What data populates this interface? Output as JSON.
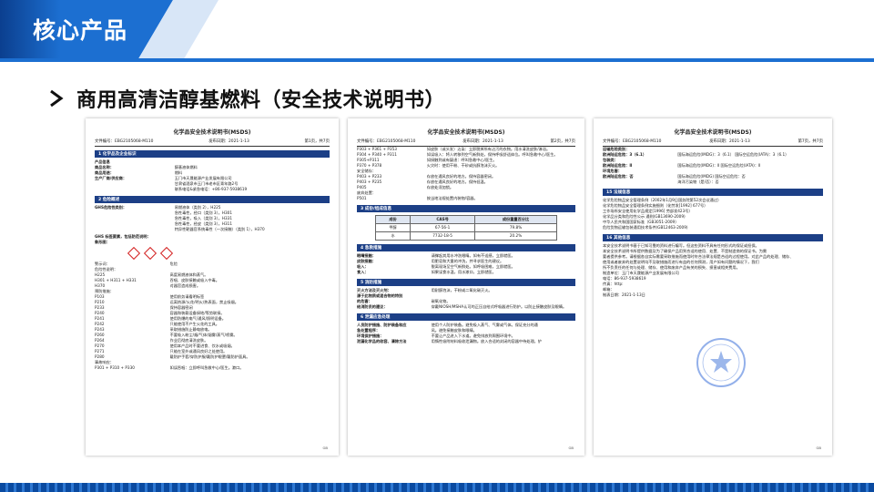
{
  "header": {
    "title": "核心产品",
    "bg_color": "#1c6fd1",
    "accent_color": "#0b3f8f"
  },
  "subtitle": {
    "icon": "triangle-arrow-icon",
    "text": "商用高清洁醇基燃料（安全技术说明书）"
  },
  "docs": [
    {
      "title": "化学品安全技术说明书(MSDS)",
      "meta": [
        "文件编号：EBG2105068-M110",
        "发布日期：2021-1-13",
        "第1页，共7页"
      ],
      "sections": [
        {
          "heading": "1 化学品及企业标识",
          "rows": [
            [
              "产品信息",
              ""
            ],
            [
              "商品名称：",
              "醇基液体燃料"
            ],
            [
              "商品用途：",
              "燃料"
            ],
            [
              "生产厂商/供应商：",
              "玉门市天晟能源产业发展有限公司"
            ],
            [
              "",
              "甘肃省酒泉市玉门市老市区青年路2号"
            ],
            [
              "",
              "联系电话&紧急电话：+86-937-5938619"
            ]
          ]
        },
        {
          "heading": "2 危险概述",
          "rows": [
            [
              "GHS危险性类别：",
              "易燃液体（类别 2），H225"
            ],
            [
              "",
              "急性毒性，经口（类别 3），H301"
            ],
            [
              "",
              "急性毒性，吸入（类别 3），H331"
            ],
            [
              "",
              "急性毒性，经皮（类别 3），H311"
            ],
            [
              "",
              "特异性靶器官系统毒性（一次接触）（类别 1），H370"
            ]
          ]
        }
      ],
      "ghs_label": "GHS 标签要素，包括防范说明：",
      "pictogram_label": "象形图：",
      "rows_after": [
        [
          "警示词：",
          "危险"
        ],
        [
          "危险性说明：",
          ""
        ],
        [
          "H225",
          "高度易燃液体和蒸气。"
        ],
        [
          "H301 + H311 + H331",
          "吞咽、皮肤接触或吸入中毒。"
        ],
        [
          "H370",
          "对器官造成损害。"
        ],
        [
          "预防措施：",
          ""
        ],
        [
          "P103",
          "使用前务请看明标签"
        ],
        [
          "P210",
          "远离热源/火花/明火/热表面，禁止吸烟。"
        ],
        [
          "P233",
          "保持容器密闭"
        ],
        [
          "P240",
          "容器和装载设备接地/等势联接。"
        ],
        [
          "P241",
          "使用防爆的电气/通风/照明设备。"
        ],
        [
          "P242",
          "只能使用不产生火花的工具。"
        ],
        [
          "P243",
          "采取措施防止静电放电。"
        ],
        [
          "P260",
          "不要吸入粉尘/烟/气体/烟雾/蒸气/喷雾。"
        ],
        [
          "P264",
          "作业后彻底清洗皮肤。"
        ],
        [
          "P270",
          "使用本产品时不要进食、饮水或吸烟。"
        ],
        [
          "P271",
          "只能在室外或通风良好之处使用。"
        ],
        [
          "P280",
          "戴防护手套/穿防护服/戴防护眼罩/戴防护面具。"
        ],
        [
          "事故响应：",
          ""
        ],
        [
          "P301 + P310 + P330",
          "如误吞咽：立即呼叫急救中心/医生。漱口。"
        ]
      ],
      "footer": "GB"
    },
    {
      "title": "化学品安全技术说明书(MSDS)",
      "meta": [
        "文件编号：EBG2105068-M110",
        "发布日期：2021-1-13",
        "第2页，共7页"
      ],
      "rows_top": [
        [
          "P303 + P361 + P353",
          "如皮肤（或头发）沾染：立即脱掉所有沾污的衣物。用水清洗皮肤/淋浴。"
        ],
        [
          "P304 + P340 + P311",
          "如误吸入：将人转移到空气新鲜处，保持呼吸舒适体位。呼叫急救中心/医生。"
        ],
        [
          "P305+P311",
          "如接触到或有疑虑：呼叫急救中心/医生。"
        ],
        [
          "P370 + P378",
          "火灾时：使用干粉、干砂或抗醇泡沫灭火。"
        ],
        [
          "安全储存：",
          ""
        ],
        [
          "P403 + P233",
          "存放在通风良好的地方。保持容器密闭。"
        ],
        [
          "P403 + P235",
          "存放在通风良好的地方。保持低温。"
        ],
        [
          "P405",
          "存放处须加锁。"
        ],
        [
          "废弃处置：",
          ""
        ],
        [
          "P501",
          "按当地法规处置内装物/容器。"
        ]
      ],
      "sec3": "3 成份/组成信息",
      "comp_table": {
        "headers": [
          "成份",
          "CAS号",
          "成份重量百分比"
        ],
        "rows": [
          [
            "甲醇",
            "67-56-1",
            "79.8%"
          ],
          [
            "水",
            "7732-18-5",
            "20.2%"
          ]
        ]
      },
      "sec4": "4 急救措施",
      "rows4": [
        [
          "眼睛接触：",
          "请撑起其用水冲洗眼睛。如有不适感，立即就医。"
        ],
        [
          "皮肤接触：",
          "用肥皂和大量的冲洗，并寻求医生的建议。"
        ],
        [
          "吸入：",
          "脱离现场至空气新鲜处。如呼吸困难，立即就医。"
        ],
        [
          "食入：",
          "如果误食水温，用水漱口，立即就医。"
        ]
      ],
      "sec5": "5 消防措施",
      "rows5": [
        [
          "灭火方法及灭火剂：",
          "用耐醇泡沫，干粉或二氧化碳灭火。"
        ],
        [
          "源于此物质或混合物的特别",
          ""
        ],
        [
          "的危害：",
          "碳氧化物。"
        ],
        [
          "给消防员的建议：",
          "穿戴NIOSH/MSHA认可的正压自给式呼吸器进行防护。以防止接触皮肤及眼睛。"
        ]
      ],
      "sec6": "6 泄漏应急处理",
      "rows6": [
        [
          "人员防护措施、防护装备和应",
          "使用个人防护装备。避免吸入蒸气、气雾或气体。保证充分的通"
        ],
        [
          "急处置程序：",
          "风。避免接触皮肤和眼睛。"
        ],
        [
          "环境保护措施：",
          "不要让产品进入下水道。避免排放到周围环境中。"
        ],
        [
          "泄漏化学品的收容、清除方法",
          "用惰性吸附材料吸收泄漏物。放入合适的封闭的容器中待处理。铲"
        ]
      ],
      "footer": "GB"
    },
    {
      "title": "化学品安全技术说明书(MSDS)",
      "meta": [
        "文件编号：EBG2105068-M110",
        "发布日期：2021-1-13",
        "第7页，共7页"
      ],
      "rows_top": [
        [
          "运输危险类别：",
          ""
        ],
        [
          "欧洲陆运危险：3（6.1）",
          "国际海运危险(IMDG)：3（6.1）    国际空运危险(IATA)：3（6.1）"
        ],
        [
          "包装类：",
          ""
        ],
        [
          "欧洲陆运危险：Ⅱ",
          "国际海运危险(IMDG)：Ⅱ    国际空运危险(IATA)：Ⅱ"
        ],
        [
          "环境危害：",
          ""
        ],
        [
          "欧洲陆运危险：否",
          "国际海运危险(IMDG)    国际空运危险：否"
        ],
        [
          "",
          "海洋污染物（是/否）：否"
        ]
      ],
      "sec15": "15 法规信息",
      "lines15": [
        "化学危险物品安全管理条例（2002年1月9日国务院第52次会议通过）",
        "化学危险物品安全管理条例实施细则（化劳发[1992] 677号）",
        "工作场所安全使用化学品规定[1996] 劳部发423号）",
        "化学品分类和危险性公示 通则(GB13690-2009)",
        "中华人民共和国国家标准（GB3051-2009）",
        "危险货物运输包装通用技术条件(GB12463-2009)"
      ],
      "sec16": "16 其他信息",
      "lines16": [
        "本安全技术说明书基于已知可靠的资料进行编写。但这些资料不具有任何形式的保证或担保。",
        "本安全技术说明书所提供数据及为了确保产品用到合适的使用、处置、不是制造商的保证书。为需",
        "要者提供参考。请根据各自实际需要采取措施而使用时符合法律法规是合适的过程使用。对此产品的处理、储存、",
        "使用或者废弃的处置说明均不及取措施而进行有益的任何预测，用户如有问题的情况下，我们",
        "所不负责任的任何与处理、储存、使用和废弃产品有关的损失、损害或相关费用。"
      ],
      "sig_lines": [
        "制造单位：玉门市天晟能源产业发展有限公司",
        "电话：86-937-5938619",
        "传真：http:",
        "邮箱：",
        "制表日期：2021-1-13日"
      ],
      "footer": "GB"
    }
  ],
  "colors": {
    "section_bar": "#1c3f86",
    "stripe_dark": "#0a4aa0",
    "stripe_light": "#2f78d2",
    "ghs_red": "#d32020"
  }
}
